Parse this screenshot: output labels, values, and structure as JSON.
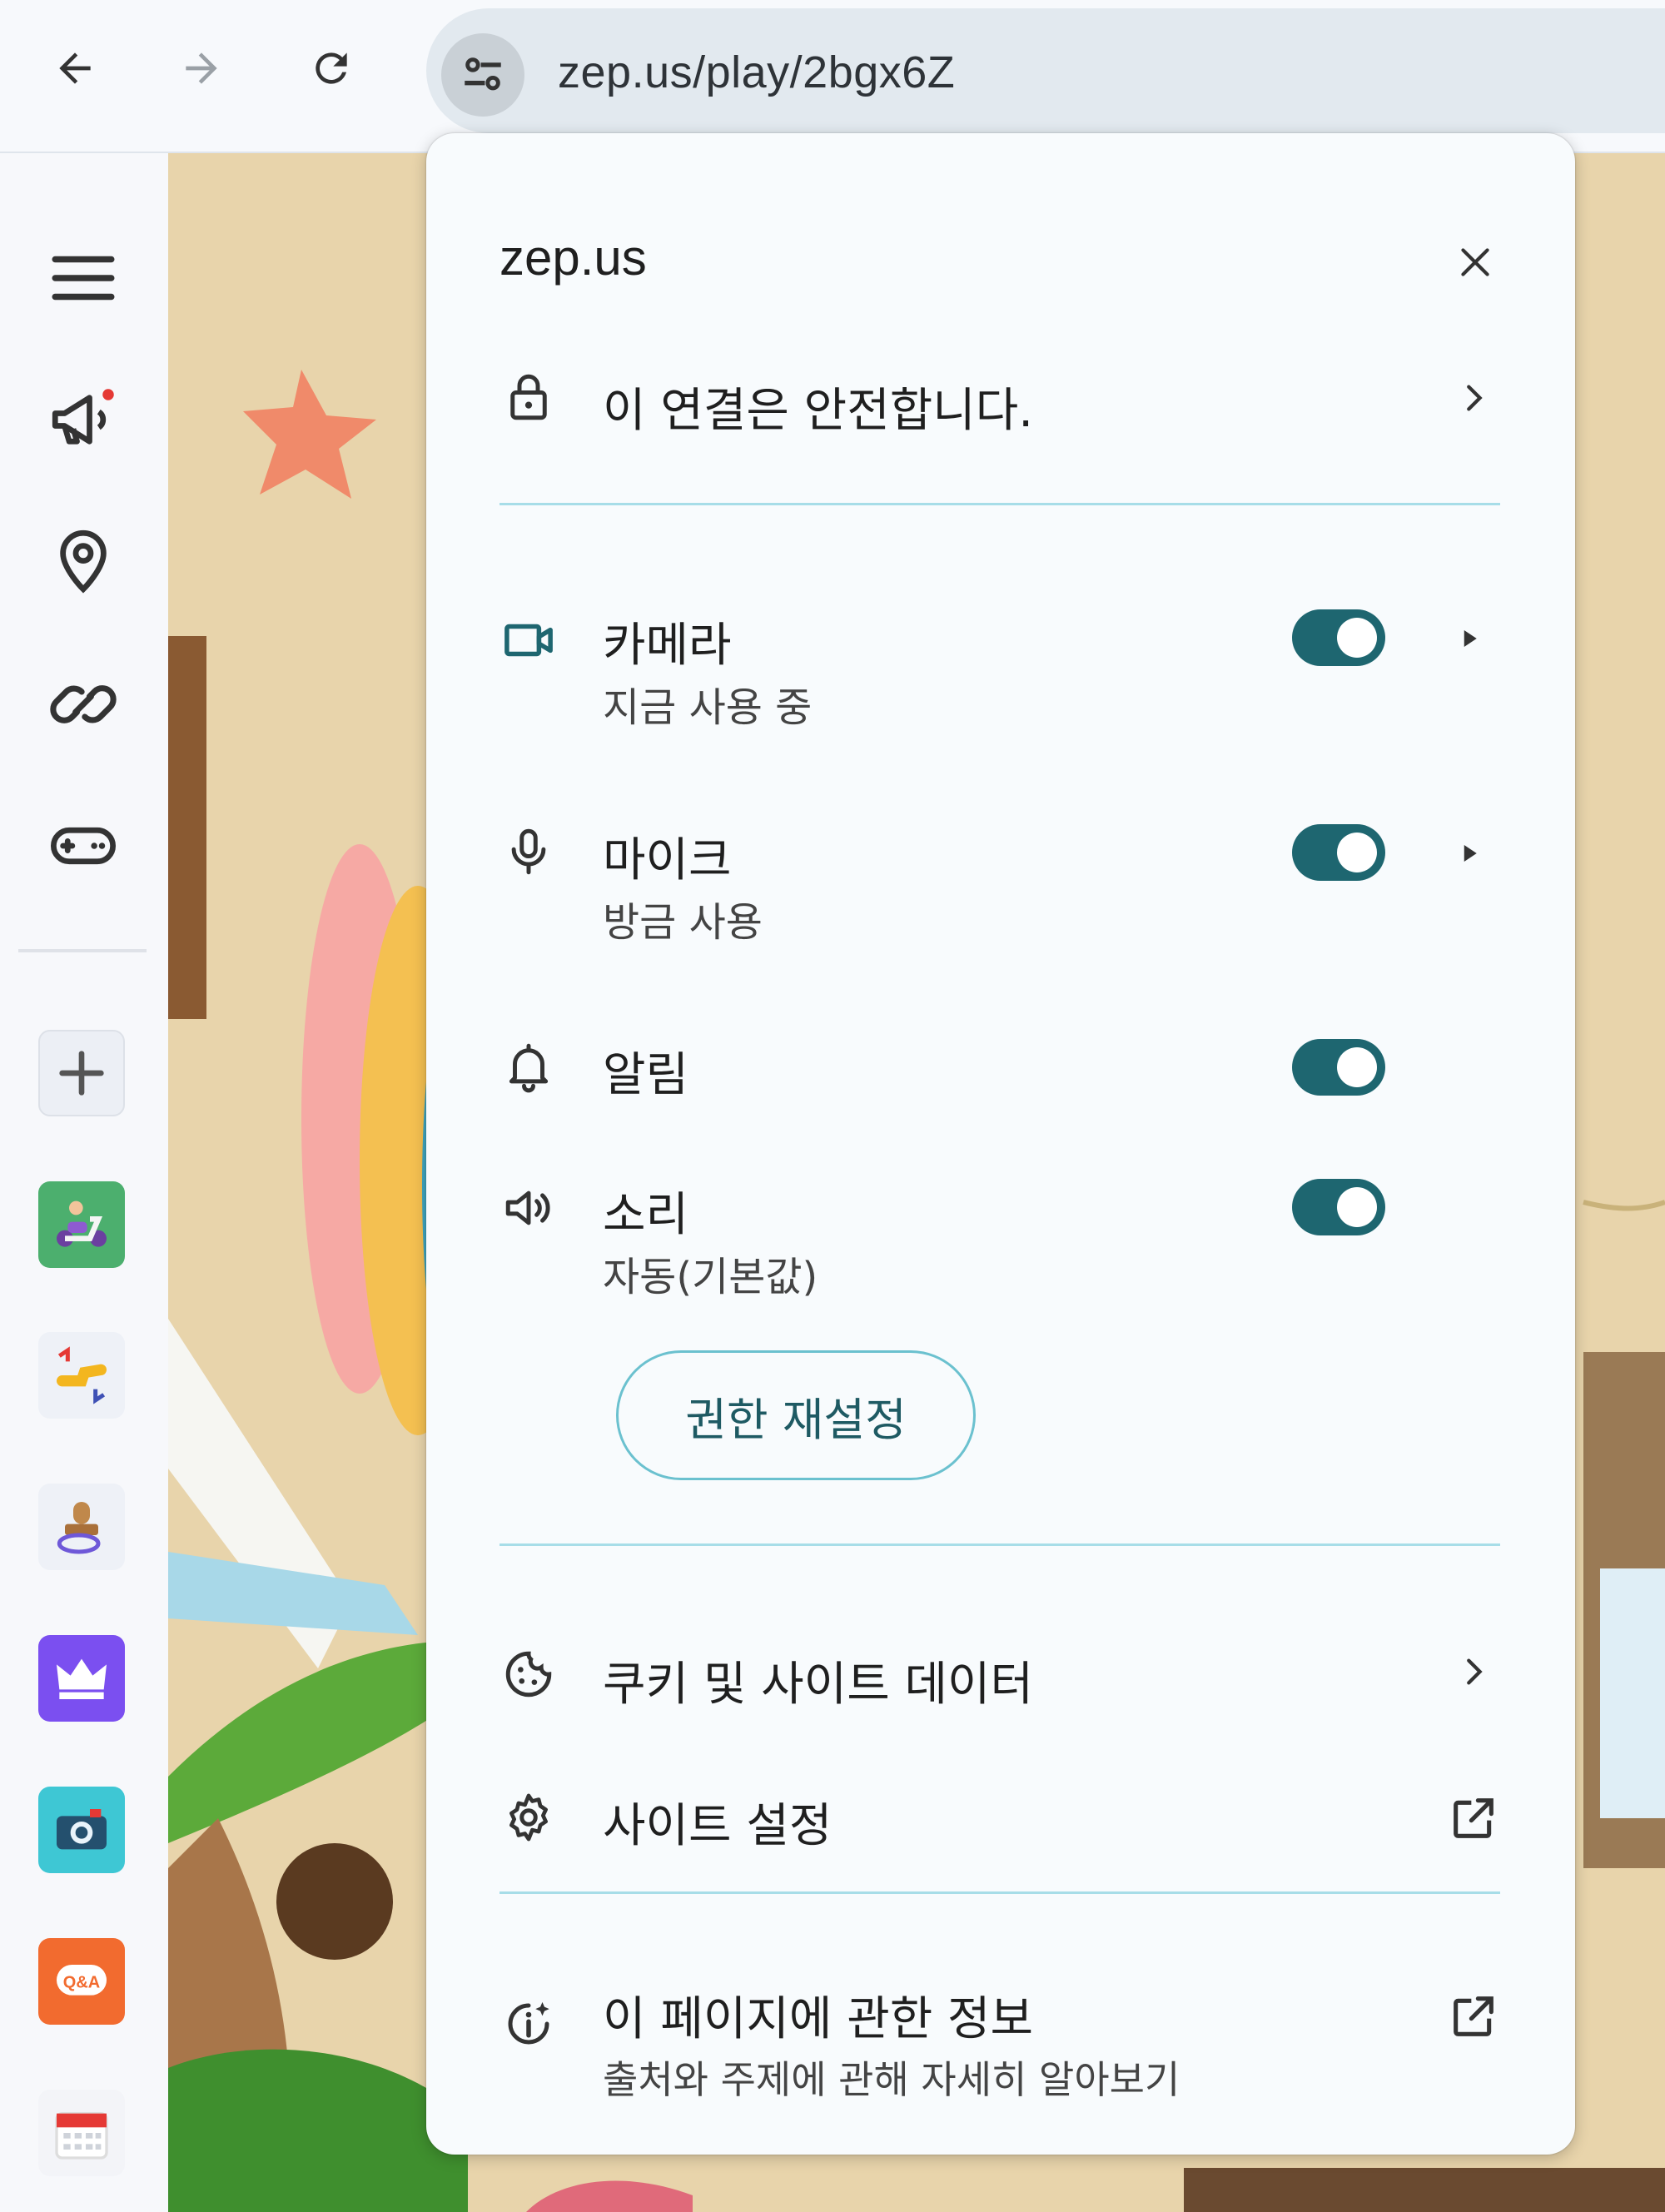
{
  "browser": {
    "url": "zep.us/play/2bgx6Z",
    "icons": {
      "back": "arrow-left-icon",
      "forward": "arrow-right-icon",
      "reload": "reload-icon",
      "site_info": "tune-icon"
    }
  },
  "sidebar": {
    "icons": [
      "menu-icon",
      "megaphone-icon",
      "map-pin-icon",
      "link-icon",
      "gamepad-icon"
    ],
    "add_button": "plus-icon",
    "apps": [
      "scooter-app",
      "swap-hand-app",
      "stamp-app",
      "crown-app",
      "camera-app",
      "qna-app",
      "calendar-app"
    ],
    "qna_text": "Q&A",
    "notification_dot_color": "#e53935"
  },
  "popup": {
    "site": "zep.us",
    "connection": {
      "label": "이 연결은 안전합니다."
    },
    "permissions": [
      {
        "key": "camera",
        "label": "카메라",
        "sub": "지금 사용 중",
        "enabled": true,
        "icon": "video-camera-icon"
      },
      {
        "key": "mic",
        "label": "마이크",
        "sub": "방금 사용",
        "enabled": true,
        "icon": "microphone-icon"
      },
      {
        "key": "notifications",
        "label": "알림",
        "sub": "",
        "enabled": true,
        "icon": "bell-icon"
      },
      {
        "key": "sound",
        "label": "소리",
        "sub": "자동(기본값)",
        "enabled": true,
        "icon": "speaker-icon"
      }
    ],
    "reset_button": "권한 재설정",
    "cookies": {
      "label": "쿠키 및 사이트 데이터"
    },
    "site_settings": {
      "label": "사이트 설정"
    },
    "about": {
      "label": "이 페이지에 관한 정보",
      "sub": "출처와 주제에 관해 자세히 알아보기"
    },
    "colors": {
      "toggle_on": "#1e6670",
      "divider": "#a7dde8",
      "accent_icon": "#1e6670"
    }
  }
}
